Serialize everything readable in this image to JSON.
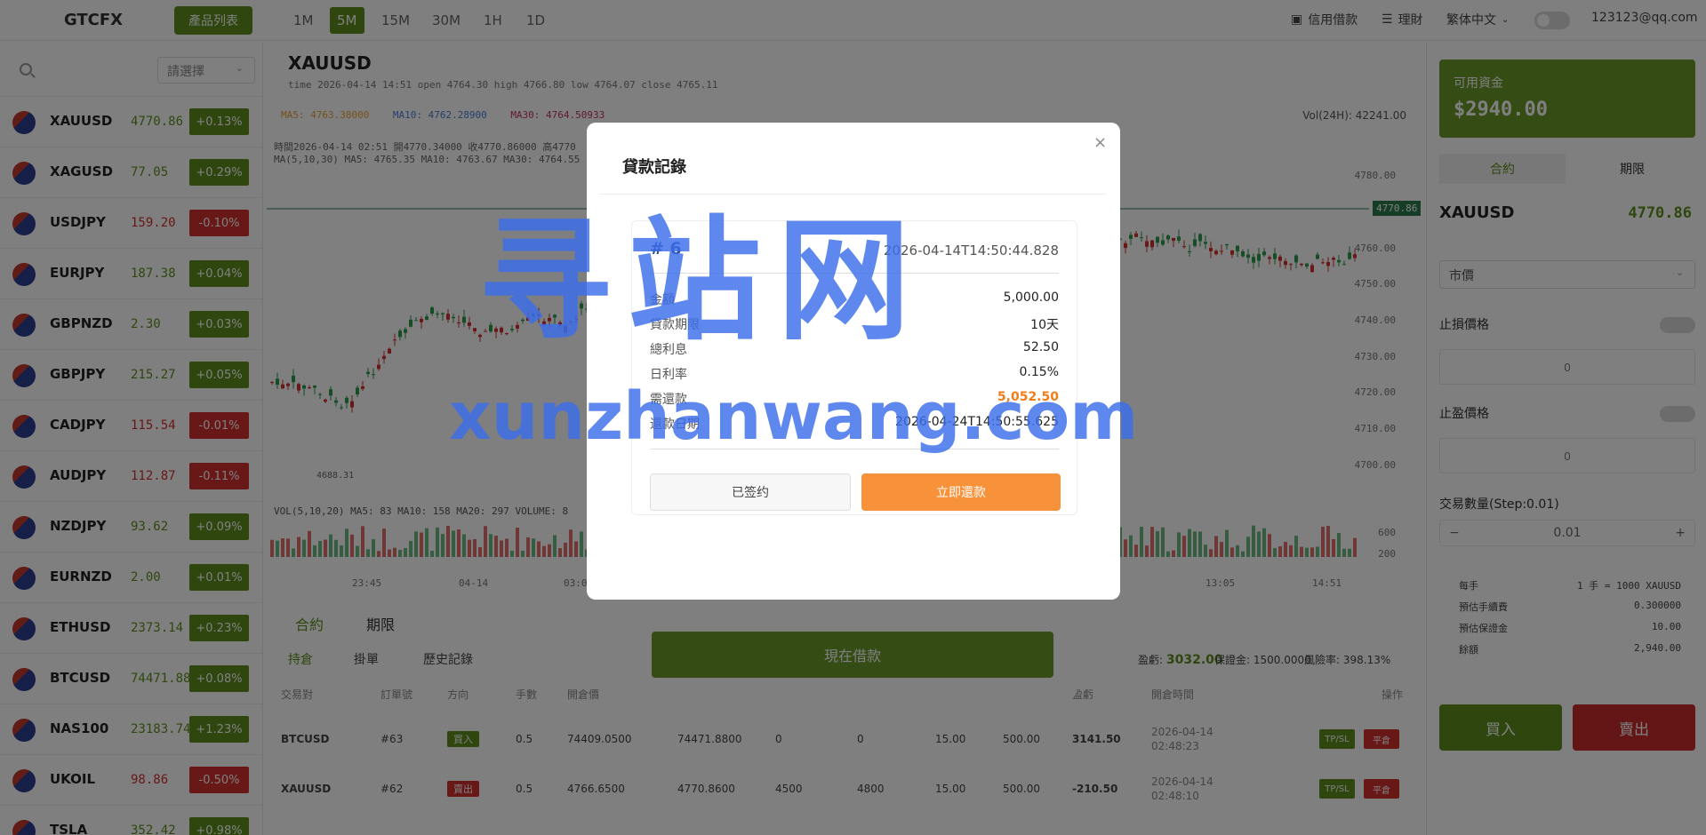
{
  "header": {
    "logo": "GTCFX",
    "product_list_btn": "產品列表",
    "timeframes": [
      "1M",
      "5M",
      "15M",
      "30M",
      "1H",
      "1D"
    ],
    "active_timeframe": "5M",
    "credit_loan": "信用借款",
    "finance": "理財",
    "language": "繁体中文",
    "user_email": "123123@qq.com"
  },
  "sidebar": {
    "filter_placeholder": "請選擇",
    "symbols": [
      {
        "name": "XAUUSD",
        "price": "4770.86",
        "change": "+0.13%",
        "dir": "up"
      },
      {
        "name": "XAGUSD",
        "price": "77.05",
        "change": "+0.29%",
        "dir": "up"
      },
      {
        "name": "USDJPY",
        "price": "159.20",
        "change": "-0.10%",
        "dir": "down"
      },
      {
        "name": "EURJPY",
        "price": "187.38",
        "change": "+0.04%",
        "dir": "up"
      },
      {
        "name": "GBPNZD",
        "price": "2.30",
        "change": "+0.03%",
        "dir": "up"
      },
      {
        "name": "GBPJPY",
        "price": "215.27",
        "change": "+0.05%",
        "dir": "up"
      },
      {
        "name": "CADJPY",
        "price": "115.54",
        "change": "-0.01%",
        "dir": "down"
      },
      {
        "name": "AUDJPY",
        "price": "112.87",
        "change": "-0.11%",
        "dir": "down"
      },
      {
        "name": "NZDJPY",
        "price": "93.62",
        "change": "+0.09%",
        "dir": "up"
      },
      {
        "name": "EURNZD",
        "price": "2.00",
        "change": "+0.01%",
        "dir": "up"
      },
      {
        "name": "ETHUSD",
        "price": "2373.14",
        "change": "+0.23%",
        "dir": "up"
      },
      {
        "name": "BTCUSD",
        "price": "74471.88",
        "change": "+0.08%",
        "dir": "up"
      },
      {
        "name": "NAS100",
        "price": "23183.74",
        "change": "+1.23%",
        "dir": "up"
      },
      {
        "name": "UKOIL",
        "price": "98.86",
        "change": "-0.50%",
        "dir": "down"
      },
      {
        "name": "TSLA",
        "price": "352.42",
        "change": "+0.98%",
        "dir": "up"
      }
    ]
  },
  "chart": {
    "symbol": "XAUUSD",
    "ohlc_line": "time 2026-04-14 14:51  open 4764.30  high 4766.80  low 4764.07  close 4765.11",
    "ma5": "MA5: 4763.38000",
    "ma10": "MA10: 4762.28900",
    "ma30": "MA30: 4764.50933",
    "vol24": "Vol(24H): 42241.00",
    "info1": "時間2026-04-14 02:51   開4770.34000   收4770.86000   高4770",
    "info2": "MA(5,10,30)    MA5: 4765.35   MA10: 4763.67   MA30: 4764.55",
    "price_tag": "4770.86",
    "y_labels": [
      "4780.00",
      "4760.00",
      "4750.00",
      "4740.00",
      "4730.00",
      "4720.00",
      "4710.00",
      "4700.00"
    ],
    "low_label": "4688.31",
    "vol_line": "VOL(5,10,20)   MA5: 83   MA10: 158   MA20: 297   VOLUME: 8",
    "vol_y": [
      "600",
      "200"
    ],
    "x_labels": [
      "23:45",
      "04-14",
      "03:0",
      "13:05",
      "14:51"
    ]
  },
  "bottom": {
    "tab_contract": "合約",
    "tab_period": "期限",
    "sub_holdings": "持倉",
    "sub_orders": "掛單",
    "sub_history": "歷史記錄",
    "pnl_label": "盈虧:",
    "pnl_value": "3032.00",
    "margin": "保證金: 1500.0000",
    "risk": "風險率: 398.13%",
    "headers": [
      "交易對",
      "訂單號",
      "方向",
      "手數",
      "開倉價",
      "",
      "",
      "",
      "",
      "",
      "",
      "",
      "盈虧",
      "開倉時間",
      "操作"
    ],
    "rows": [
      {
        "pair": "BTCUSD",
        "order": "#63",
        "dir": "買入",
        "dir_type": "buy",
        "lots": "0.5",
        "open": "74409.0500",
        "cur": "74471.8800",
        "tp": "0",
        "sl": "0",
        "fee": "15.00",
        "margin": "500.00",
        "pnl": "3141.50",
        "pnl_type": "up",
        "time1": "2026-04-14",
        "time2": "02:48:23"
      },
      {
        "pair": "XAUUSD",
        "order": "#62",
        "dir": "賣出",
        "dir_type": "sell",
        "lots": "0.5",
        "open": "4766.6500",
        "cur": "4770.8600",
        "tp": "4500",
        "sl": "4800",
        "fee": "15.00",
        "margin": "500.00",
        "pnl": "-210.50",
        "pnl_type": "down",
        "time1": "2026-04-14",
        "time2": "02:48:10"
      }
    ],
    "tpsl_btn": "TP/SL",
    "close_btn": "平倉"
  },
  "right": {
    "available_label": "可用資金",
    "available_value": "$2940.00",
    "tab_contract": "合約",
    "tab_period": "期限",
    "symbol": "XAUUSD",
    "price": "4770.86",
    "order_type": "市價",
    "stop_loss": "止損價格",
    "take_profit": "止盈價格",
    "input_placeholder": "0",
    "qty_label": "交易數量(Step:0.01)",
    "qty_minus": "−",
    "qty_value": "0.01",
    "qty_plus": "+",
    "details": [
      {
        "k": "每手",
        "v": "1 手 = 1000 XAUUSD"
      },
      {
        "k": "預估手續費",
        "v": "0.300000"
      },
      {
        "k": "預估保證金",
        "v": "10.00"
      },
      {
        "k": "餘額",
        "v": "2,940.00"
      }
    ],
    "buy": "買入",
    "sell": "賣出"
  },
  "loan_panel": {
    "borrow_btn": "現在借款"
  },
  "modal": {
    "title": "貸款記錄",
    "close": "×",
    "record": {
      "id": "# 6",
      "time": "2026-04-14T14:50:44.828",
      "amount_label": "金額",
      "amount": "5,000.00",
      "term_label": "貸款期限",
      "term": "10天",
      "interest_label": "總利息",
      "interest": "52.50",
      "rate_label": "日利率",
      "rate": "0.15%",
      "due_label": "需還款",
      "due": "5,052.50",
      "repay_date_label": "還款日期",
      "repay_date": "2026-04-24T14:50:55.625",
      "signed_btn": "已签约",
      "repay_btn": "立即還款"
    }
  },
  "watermark": {
    "cn": "寻站网",
    "en": "xunzhanwang.com"
  },
  "colors": {
    "green": "#5e8f1e",
    "red": "#d0312d",
    "orange": "#f7923a"
  }
}
